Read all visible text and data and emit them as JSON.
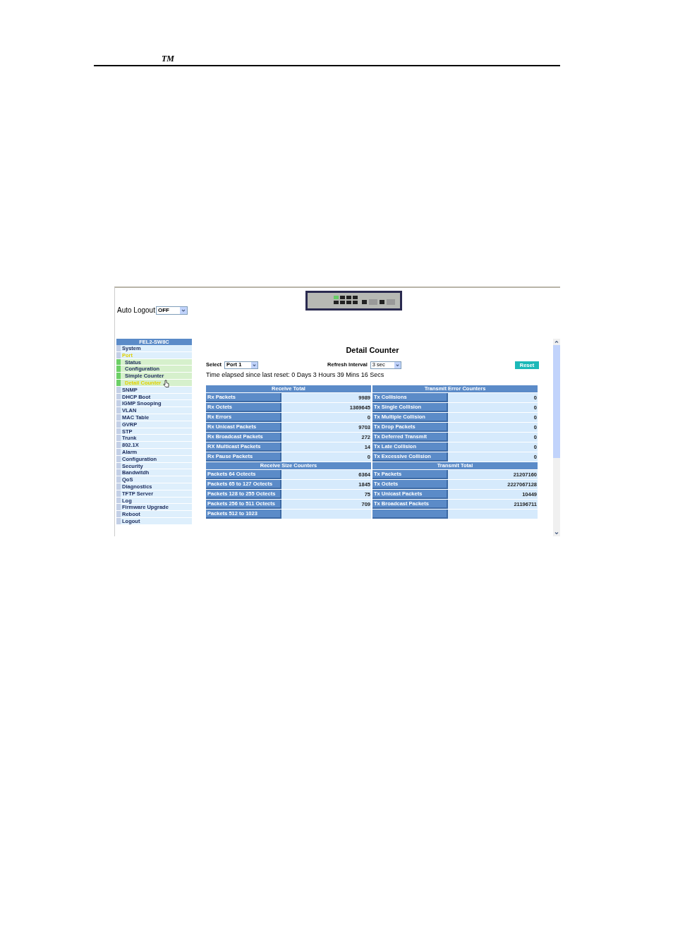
{
  "page_header": {
    "mark": "TM"
  },
  "screen": {
    "auto_logout": {
      "label": "Auto Logout",
      "value": "OFF"
    },
    "sidebar": {
      "title": "FEL2-SW8C",
      "items": [
        {
          "label": "System",
          "selected": false
        },
        {
          "label": "Port",
          "selected": true,
          "children": [
            {
              "label": "Status",
              "selected": false
            },
            {
              "label": "Configuration",
              "selected": false
            },
            {
              "label": "Simple Counter",
              "selected": false
            },
            {
              "label": "Detail Counter",
              "selected": true
            }
          ]
        },
        {
          "label": "SNMP",
          "selected": false
        },
        {
          "label": "DHCP Boot",
          "selected": false
        },
        {
          "label": "IGMP Snooping",
          "selected": false
        },
        {
          "label": "VLAN",
          "selected": false
        },
        {
          "label": "MAC Table",
          "selected": false
        },
        {
          "label": "GVRP",
          "selected": false
        },
        {
          "label": "STP",
          "selected": false
        },
        {
          "label": "Trunk",
          "selected": false
        },
        {
          "label": "802.1X",
          "selected": false
        },
        {
          "label": "Alarm",
          "selected": false
        },
        {
          "label": "Configuration",
          "selected": false
        },
        {
          "label": "Security",
          "selected": false
        },
        {
          "label": "Bandwitdh",
          "selected": false
        },
        {
          "label": "QoS",
          "selected": false
        },
        {
          "label": "Diagnostics",
          "selected": false
        },
        {
          "label": "TFTP Server",
          "selected": false
        },
        {
          "label": "Log",
          "selected": false
        },
        {
          "label": "Firmware Upgrade",
          "selected": false
        },
        {
          "label": "Reboot",
          "selected": false
        },
        {
          "label": "Logout",
          "selected": false
        }
      ]
    },
    "title": "Detail Counter",
    "select": {
      "label": "Select",
      "value": "Port 1"
    },
    "refresh": {
      "label": "Refresh Interval",
      "value": "3 sec"
    },
    "reset_button": "Reset",
    "elapsed": "Time elapsed since last reset: 0 Days 3 Hours 39 Mins 16 Secs",
    "sections": [
      {
        "left_title": "Receive Total",
        "right_title": "Transmit Error Counters",
        "rows": [
          {
            "left_label": "Rx Packets",
            "left_value": "9989",
            "right_label": "Tx Collisions",
            "right_value": "0"
          },
          {
            "left_label": "Rx Octets",
            "left_value": "1369645",
            "right_label": "Tx Single Collision",
            "right_value": "0"
          },
          {
            "left_label": "Rx Errors",
            "left_value": "0",
            "right_label": "Tx Multiple Collision",
            "right_value": "0"
          },
          {
            "left_label": "Rx Unicast Packets",
            "left_value": "9703",
            "right_label": "Tx Drop Packets",
            "right_value": "0"
          },
          {
            "left_label": "Rx Broadcast Packets",
            "left_value": "272",
            "right_label": "Tx Deferred Transmit",
            "right_value": "0"
          },
          {
            "left_label": "RX Multicast Packets",
            "left_value": "14",
            "right_label": "Tx Late Collision",
            "right_value": "0"
          },
          {
            "left_label": "Rx Pause Packets",
            "left_value": "0",
            "right_label": "Tx Excessive Collision",
            "right_value": "0"
          }
        ]
      },
      {
        "left_title": "Receive Size Counters",
        "right_title": "Transmit Total",
        "rows": [
          {
            "left_label": "Packets 64 Octects",
            "left_value": "6364",
            "right_label": "Tx Packets",
            "right_value": "21207160"
          },
          {
            "left_label": "Packets 65 to 127 Octects",
            "left_value": "1845",
            "right_label": "Tx Octets",
            "right_value": "2227067128"
          },
          {
            "left_label": "Packets 128 to 255 Octects",
            "left_value": "75",
            "right_label": "Tx Unicast Packets",
            "right_value": "10449"
          },
          {
            "left_label": "Packets 256 to 511 Octects",
            "left_value": "709",
            "right_label": "Tx Broadcast Packets",
            "right_value": "21196711"
          },
          {
            "left_label": "Packets 512 to 1023"
          }
        ]
      }
    ]
  }
}
